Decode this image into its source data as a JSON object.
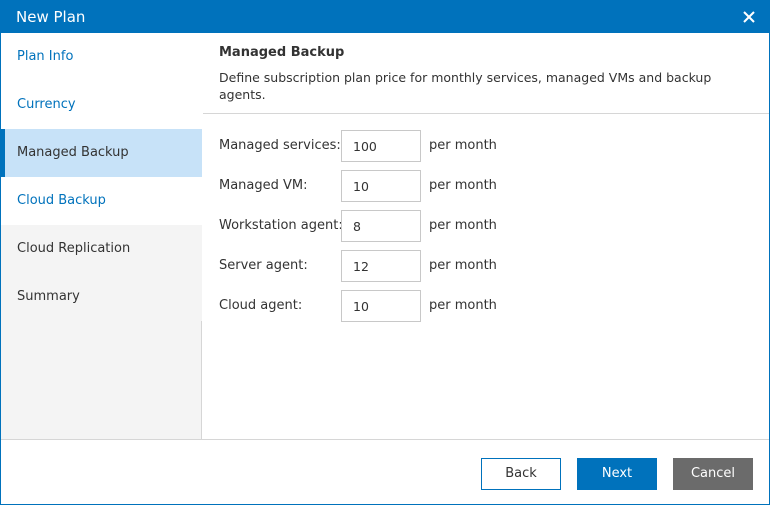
{
  "window": {
    "title": "New Plan",
    "close_icon": "close-icon"
  },
  "colors": {
    "accent": "#0072bc",
    "active_step_bg": "#c7e2f8",
    "sidebar_bg": "#f4f4f4",
    "cancel_bg": "#6b6b6b"
  },
  "sidebar": {
    "items": [
      {
        "label": "Plan Info",
        "state": "done"
      },
      {
        "label": "Currency",
        "state": "done"
      },
      {
        "label": "Managed Backup",
        "state": "active"
      },
      {
        "label": "Cloud Backup",
        "state": "done"
      },
      {
        "label": "Cloud Replication",
        "state": "pending"
      },
      {
        "label": "Summary",
        "state": "pending"
      }
    ]
  },
  "header": {
    "title": "Managed Backup",
    "description": "Define subscription plan price for monthly services, managed VMs and backup agents."
  },
  "form": {
    "rows": [
      {
        "label": "Managed services:",
        "value": "100",
        "unit": "per month"
      },
      {
        "label": "Managed VM:",
        "value": "10",
        "unit": "per month"
      },
      {
        "label": "Workstation agent:",
        "value": "8",
        "unit": "per month"
      },
      {
        "label": "Server agent:",
        "value": "12",
        "unit": "per month"
      },
      {
        "label": "Cloud agent:",
        "value": "10",
        "unit": "per month"
      }
    ]
  },
  "footer": {
    "back_label": "Back",
    "next_label": "Next",
    "cancel_label": "Cancel"
  }
}
